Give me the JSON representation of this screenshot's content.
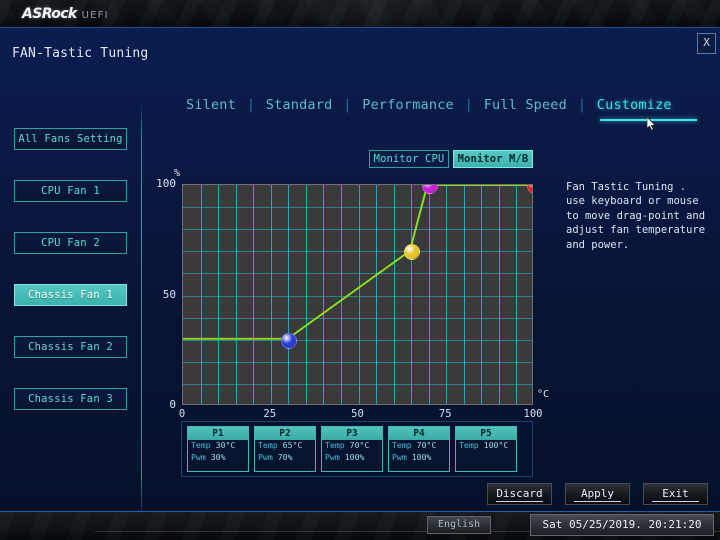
{
  "window": {
    "brand": "ASRock",
    "brand_suffix": "UEFI",
    "page_title": "FAN-Tastic Tuning",
    "close_label": "X"
  },
  "tabs": [
    {
      "label": "Silent",
      "active": false
    },
    {
      "label": "Standard",
      "active": false
    },
    {
      "label": "Performance",
      "active": false
    },
    {
      "label": "Full Speed",
      "active": false
    },
    {
      "label": "Customize",
      "active": true
    }
  ],
  "tab_separator": "|",
  "sidebar": {
    "items": [
      {
        "label": "All Fans Setting",
        "selected": false
      },
      {
        "label": "CPU Fan 1",
        "selected": false
      },
      {
        "label": "CPU Fan 2",
        "selected": false
      },
      {
        "label": "Chassis Fan 1",
        "selected": true
      },
      {
        "label": "Chassis Fan 2",
        "selected": false
      },
      {
        "label": "Chassis Fan 3",
        "selected": false
      }
    ]
  },
  "monitor": {
    "cpu_label": "Monitor CPU",
    "mb_label": "Monitor M/B",
    "active": "Monitor M/B"
  },
  "description": "Fan Tastic Tuning . use keyboard or mouse to move drag-point and adjust fan temperature and power.",
  "chart_data": {
    "type": "line",
    "title": "",
    "xlabel": "°C",
    "ylabel": "%",
    "xlim": [
      0,
      100
    ],
    "ylim": [
      0,
      100
    ],
    "x_ticks": [
      0,
      25,
      50,
      75,
      100
    ],
    "y_ticks": [
      0,
      50,
      100
    ],
    "x_tick_labels": [
      "0",
      "25",
      "50",
      "75",
      "100"
    ],
    "y_tick_labels": [
      "0",
      "50",
      "100"
    ],
    "grid": true,
    "grid_x_step": 5,
    "grid_y_step": 10,
    "legend": "none",
    "series": [
      {
        "name": "Fan Curve",
        "color": "#8ddd1f",
        "x": [
          0,
          30,
          65,
          70,
          100
        ],
        "y": [
          30,
          30,
          70,
          100,
          100
        ]
      }
    ],
    "points": [
      {
        "label": "P1",
        "temp": 30,
        "pwm": 30,
        "color": "#2b3ed4"
      },
      {
        "label": "P2",
        "temp": 65,
        "pwm": 70,
        "color": "#e8c426"
      },
      {
        "label": "P3",
        "temp": 70,
        "pwm": 100,
        "color": "#c322d6"
      },
      {
        "label": "P5",
        "temp": 100,
        "pwm": 100,
        "color": "#e02020"
      }
    ]
  },
  "points_panel": {
    "temp_label": "Temp",
    "pwm_label": "Pwm",
    "items": [
      {
        "name": "P1",
        "temp": "30°C",
        "pwm": "30%"
      },
      {
        "name": "P2",
        "temp": "65°C",
        "pwm": "70%"
      },
      {
        "name": "P3",
        "temp": "70°C",
        "pwm": "100%"
      },
      {
        "name": "P4",
        "temp": "70°C",
        "pwm": "100%"
      },
      {
        "name": "P5",
        "temp": "100°C",
        "pwm": ""
      }
    ]
  },
  "actions": {
    "discard": "Discard",
    "apply": "Apply",
    "exit": "Exit"
  },
  "statusbar": {
    "language": "English",
    "datetime": "Sat 05/25/2019. 20:21:20"
  }
}
